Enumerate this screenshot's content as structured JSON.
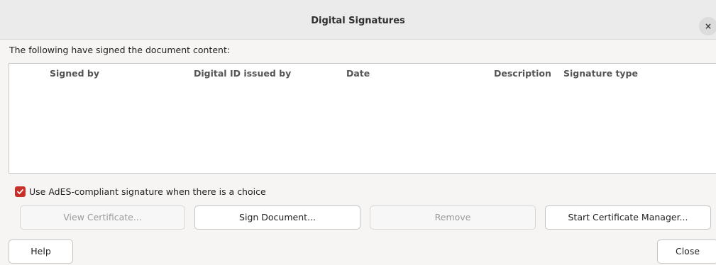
{
  "dialog": {
    "title": "Digital Signatures",
    "close_glyph": "×"
  },
  "prompt": "The following have signed the document content:",
  "table": {
    "columns": [
      "Signed by",
      "Digital ID issued by",
      "Date",
      "Description",
      "Signature type"
    ],
    "rows": []
  },
  "ades_option": {
    "label": "Use AdES-compliant signature when there is a choice",
    "checked": true,
    "color": "#c7312a"
  },
  "buttons": {
    "view_certificate": "View Certificate...",
    "sign_document": "Sign Document...",
    "remove": "Remove",
    "start_certificate_manager": "Start Certificate Manager...",
    "help": "Help",
    "close": "Close"
  }
}
